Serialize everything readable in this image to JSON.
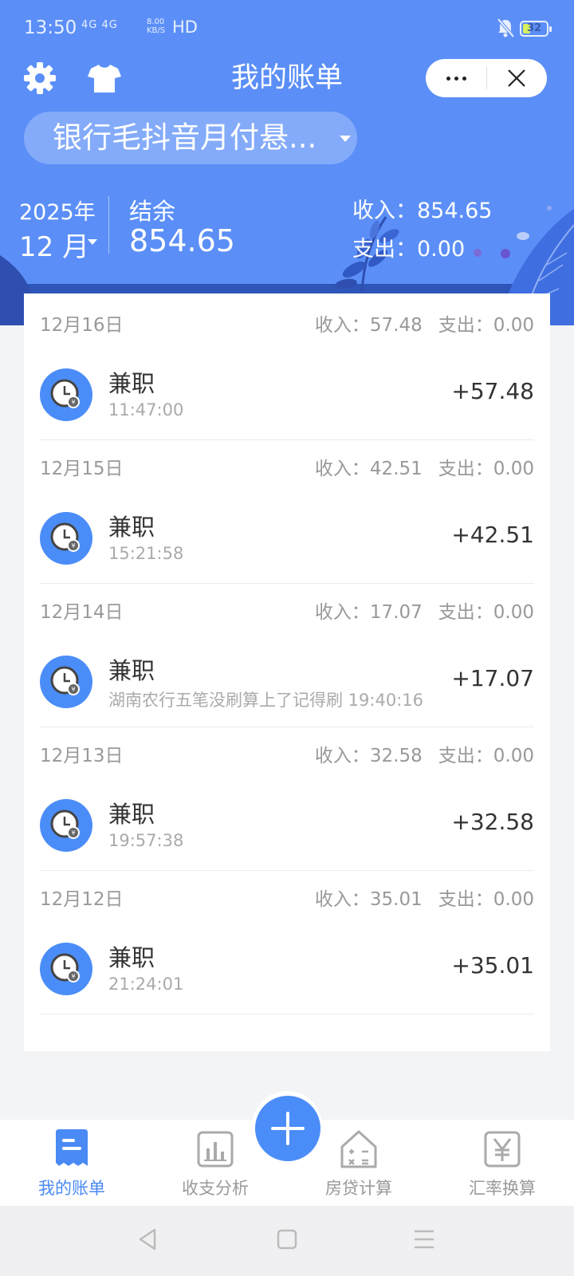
{
  "status_bar": {
    "time": "13:50",
    "signal_text": "4G 4G",
    "net_speed_value": "8.00",
    "net_speed_unit": "KB/S",
    "hd_label": "HD",
    "battery_level": "32"
  },
  "header": {
    "title": "我的账单",
    "account_selector_label": "银行毛抖音月付悬..."
  },
  "summary": {
    "year": "2025年",
    "month": "12 月",
    "balance_label": "结余",
    "balance_value": "854.65",
    "income_text": "收入：854.65",
    "expense_text": "支出：0.00"
  },
  "days": [
    {
      "date": "12月16日",
      "income": "收入：57.48",
      "expense": "支出：0.00",
      "entries": [
        {
          "title": "兼职",
          "note": " 11:47:00",
          "amount": "+57.48"
        }
      ]
    },
    {
      "date": "12月15日",
      "income": "收入：42.51",
      "expense": "支出：0.00",
      "entries": [
        {
          "title": "兼职",
          "note": " 15:21:58",
          "amount": "+42.51"
        }
      ]
    },
    {
      "date": "12月14日",
      "income": "收入：17.07",
      "expense": "支出：0.00",
      "entries": [
        {
          "title": "兼职",
          "note": "湖南农行五笔没刷算上了记得刷 19:40:16",
          "amount": "+17.07"
        }
      ]
    },
    {
      "date": "12月13日",
      "income": "收入：32.58",
      "expense": "支出：0.00",
      "entries": [
        {
          "title": "兼职",
          "note": " 19:57:38",
          "amount": "+32.58"
        }
      ]
    },
    {
      "date": "12月12日",
      "income": "收入：35.01",
      "expense": "支出：0.00",
      "entries": [
        {
          "title": "兼职",
          "note": " 21:24:01",
          "amount": "+35.01"
        }
      ]
    }
  ],
  "bottom_nav": {
    "items": [
      {
        "label": "我的账单",
        "icon": "bill-icon",
        "active": true
      },
      {
        "label": "收支分析",
        "icon": "chart-icon",
        "active": false
      },
      {
        "label": "房贷计算",
        "icon": "house-calculator-icon",
        "active": false
      },
      {
        "label": "汇率换算",
        "icon": "yen-icon",
        "active": false
      }
    ]
  },
  "colors": {
    "header_blue": "#5b8ff7",
    "accent": "#4a8af4",
    "icon_blue": "#4b8df8",
    "text_dark": "#333333",
    "text_muted": "#999999"
  }
}
